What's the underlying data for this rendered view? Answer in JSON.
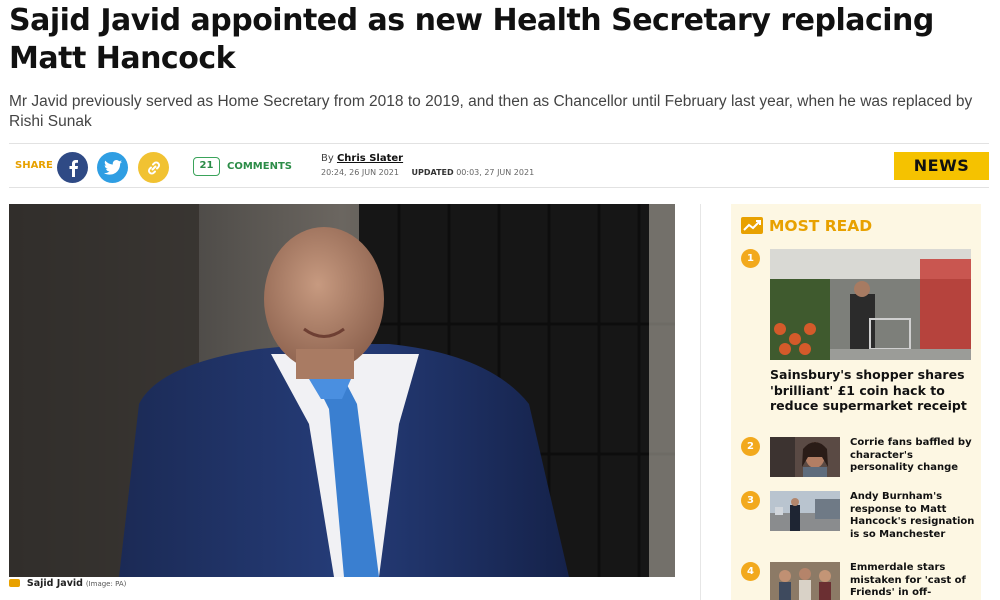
{
  "article": {
    "headline": "Sajid Javid appointed as new Health Secretary replacing Matt Hancock",
    "standfirst": "Mr Javid previously served as Home Secretary from 2018 to 2019, and then as Chancellor until February last year, when he was replaced by Rishi Sunak",
    "share_label": "SHARE",
    "comment_count": "21",
    "comments_label": "COMMENTS",
    "by_prefix": "By",
    "author": "Chris Slater",
    "published": "20:24, 26 JUN 2021",
    "updated_label": "UPDATED",
    "updated": "00:03, 27 JUN 2021",
    "section_badge": "NEWS",
    "image_caption": "Sajid Javid",
    "image_credit": "(Image: PA)"
  },
  "most_read": {
    "title": "MOST READ",
    "items": [
      {
        "rank": "1",
        "title": "Sainsbury's shopper shares 'brilliant' £1 coin hack to reduce supermarket receipt"
      },
      {
        "rank": "2",
        "title": "Corrie fans baffled by character's personality change"
      },
      {
        "rank": "3",
        "title": "Andy Burnham's response to Matt Hancock's resignation is so Manchester"
      },
      {
        "rank": "4",
        "title": "Emmerdale stars mistaken for 'cast of Friends' in off-"
      }
    ]
  },
  "icons": {
    "facebook": "facebook-icon",
    "twitter": "twitter-icon",
    "link": "link-icon",
    "trending": "trending-icon",
    "camera": "camera-icon"
  },
  "colors": {
    "accent": "#f5c200",
    "share": "#e8a100",
    "comments": "#2b8c47",
    "facebook": "#2f4a85",
    "twitter": "#2f9ee3",
    "most_read_bg": "#fdf7e3"
  }
}
